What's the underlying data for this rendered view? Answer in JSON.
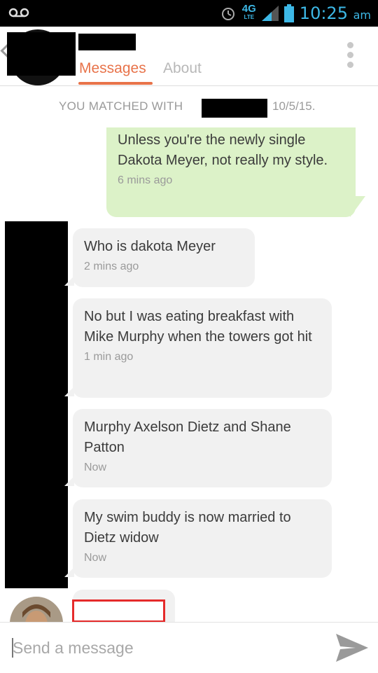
{
  "status_bar": {
    "time": "10:25",
    "ampm": "am",
    "network": "4G",
    "network_sub": "LTE"
  },
  "header": {
    "tabs": [
      {
        "label": "Messages"
      },
      {
        "label": "About"
      }
    ]
  },
  "match_banner": {
    "prefix": "YOU MATCHED WITH",
    "date": "10/5/15."
  },
  "messages": [
    {
      "direction": "sent",
      "text": "Unless you're the newly single Dakota Meyer, not really my style.",
      "time": "6 mins ago"
    },
    {
      "direction": "received",
      "text": "Who is dakota Meyer",
      "time": "2 mins ago"
    },
    {
      "direction": "received",
      "text": "No but I was eating breakfast with Mike Murphy when the towers got hit",
      "time": "1 min ago"
    },
    {
      "direction": "received",
      "text": "Murphy Axelson Dietz and Shane Patton",
      "time": "Now"
    },
    {
      "direction": "received",
      "text": "My swim buddy is now married to Dietz widow",
      "time": "Now"
    }
  ],
  "composer": {
    "placeholder": "Send a message"
  },
  "icons": {
    "voicemail": "voicemail-icon",
    "alarm": "alarm-icon",
    "signal": "signal-icon",
    "battery": "battery-icon",
    "menu": "more-vert-icon",
    "send": "send-icon"
  },
  "colors": {
    "accent": "#e8734a",
    "sent_bubble": "#dcf2c8",
    "received_bubble": "#f1f1f1",
    "status_blue": "#3db8e6"
  }
}
